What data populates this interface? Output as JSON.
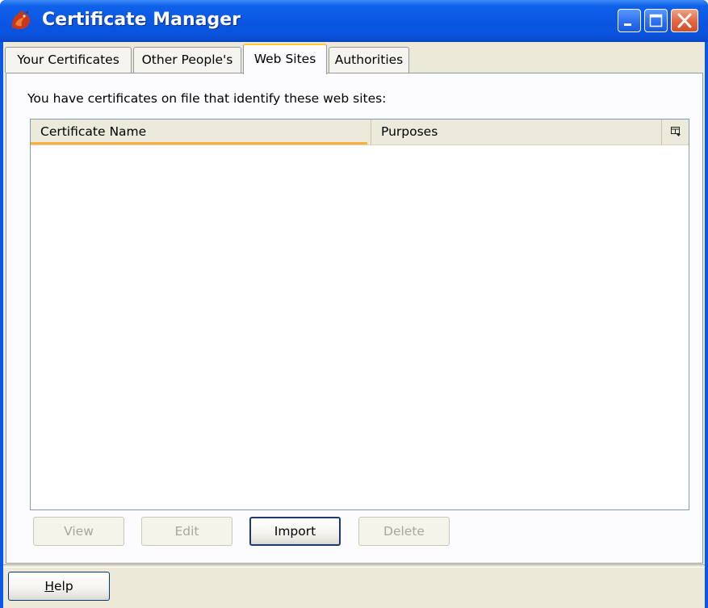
{
  "window": {
    "title": "Certificate Manager",
    "app_icon": "firefox-mozilla-icon",
    "controls": [
      "minimize-icon",
      "maximize-icon",
      "close-icon"
    ]
  },
  "tabs": [
    {
      "label": "Your Certificates",
      "selected": false
    },
    {
      "label": "Other People's",
      "selected": false
    },
    {
      "label": "Web Sites",
      "selected": true
    },
    {
      "label": "Authorities",
      "selected": false
    }
  ],
  "panel": {
    "instruction": "You have certificates on file that identify these web sites:",
    "columns": [
      {
        "label": "Certificate Name",
        "sorted": true
      },
      {
        "label": "Purposes",
        "sorted": false
      }
    ],
    "column_picker_icon": "column-picker-icon",
    "rows": []
  },
  "actions": {
    "view": {
      "label": "View",
      "enabled": false
    },
    "edit": {
      "label": "Edit",
      "enabled": false
    },
    "import": {
      "label": "Import",
      "enabled": true
    },
    "delete": {
      "label": "Delete",
      "enabled": false
    }
  },
  "footer": {
    "help_prefix": "H",
    "help_rest": "elp"
  },
  "colors": {
    "title_bar": "#0b57e3",
    "dialog_face": "#ece9d8",
    "tab_highlight": "#ffc83c",
    "sort_indicator": "#f9b23c"
  }
}
